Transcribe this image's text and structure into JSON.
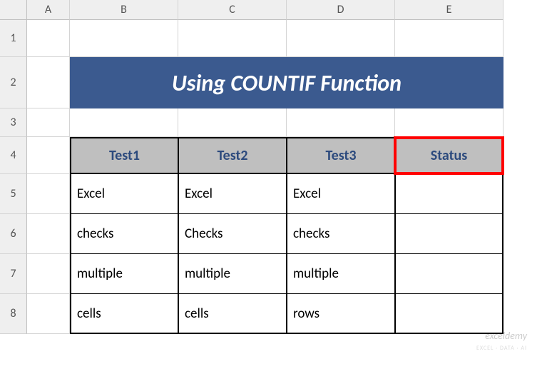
{
  "columns": [
    "A",
    "B",
    "C",
    "D",
    "E"
  ],
  "rows": [
    "1",
    "2",
    "3",
    "4",
    "5",
    "6",
    "7",
    "8"
  ],
  "title": "Using COUNTIF Function",
  "headers": {
    "test1": "Test1",
    "test2": "Test2",
    "test3": "Test3",
    "status": "Status"
  },
  "data": {
    "r5": {
      "b": "Excel",
      "c": "Excel",
      "d": "Excel",
      "e": ""
    },
    "r6": {
      "b": "checks",
      "c": "Checks",
      "d": "checks",
      "e": ""
    },
    "r7": {
      "b": "multiple",
      "c": "multiple",
      "d": "multiple",
      "e": ""
    },
    "r8": {
      "b": "cells",
      "c": "cells",
      "d": "rows",
      "e": ""
    }
  },
  "watermark": "exceldemy",
  "watermark_sub": "EXCEL · DATA · AI",
  "chart_data": {
    "type": "table",
    "title": "Using COUNTIF Function",
    "columns": [
      "Test1",
      "Test2",
      "Test3",
      "Status"
    ],
    "rows": [
      [
        "Excel",
        "Excel",
        "Excel",
        ""
      ],
      [
        "checks",
        "Checks",
        "checks",
        ""
      ],
      [
        "multiple",
        "multiple",
        "multiple",
        ""
      ],
      [
        "cells",
        "cells",
        "rows",
        ""
      ]
    ]
  }
}
